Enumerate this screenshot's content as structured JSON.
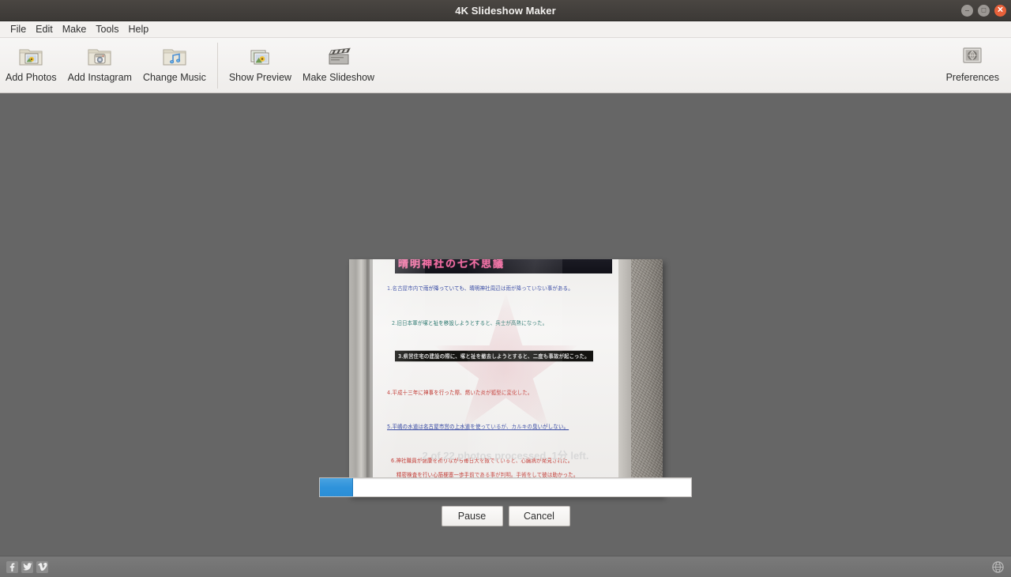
{
  "window": {
    "title": "4K Slideshow Maker",
    "controls": [
      {
        "name": "minimize",
        "glyph": "–"
      },
      {
        "name": "maximize",
        "glyph": "□"
      },
      {
        "name": "close",
        "glyph": "✕"
      }
    ]
  },
  "menubar": {
    "items": [
      {
        "label": "File"
      },
      {
        "label": "Edit"
      },
      {
        "label": "Make"
      },
      {
        "label": "Tools"
      },
      {
        "label": "Help"
      }
    ]
  },
  "toolbar": {
    "left_items": [
      {
        "label": "Add Photos",
        "icon": "folder-photo-icon"
      },
      {
        "label": "Add Instagram",
        "icon": "folder-instagram-icon"
      },
      {
        "label": "Change Music",
        "icon": "folder-music-icon"
      }
    ],
    "right_group_items": [
      {
        "label": "Show Preview",
        "icon": "photo-stack-icon"
      },
      {
        "label": "Make Slideshow",
        "icon": "clapperboard-icon"
      }
    ],
    "preferences": {
      "label": "Preferences",
      "icon": "preferences-globe-icon"
    }
  },
  "preview": {
    "alt": "photo of a Japanese notice board poster behind glass",
    "poster": {
      "header": "晴明神社の七不思議",
      "lines": [
        "1.名古屋市内で雨が降っていても、晴明神社周辺は雨が降っていない事がある。",
        "2.旧日本軍が塚と祉を移設しようとすると、兵士が高熱になった。",
        "3.県営住宅の建設の際に、塚と祉を撤去しようとすると、二度も事故が起こった。",
        "4.平成十三年に神事を行った際、燃いた炎が狐型に変化した。",
        "5.平嶋の水道は名古屋市営の上水道を使っているが、カルキの臭いがしない。",
        "6.神社職員が健康を祈りながら毎日犬を撒でていると、心臓病が発見された。",
        "精密検査を行い心筋梗塞一歩手前である事が判明。手術をして彼は助かった。"
      ]
    }
  },
  "progress": {
    "status_text": "2 of 22 photos processed, 1分 left.",
    "processed": 2,
    "total": 22,
    "time_left": "1分",
    "percent": 9,
    "fill_color": "#2f93db",
    "pause_label": "Pause",
    "cancel_label": "Cancel"
  },
  "statusbar": {
    "social": [
      {
        "name": "facebook",
        "glyph": "f"
      },
      {
        "name": "twitter",
        "glyph": "🐦"
      },
      {
        "name": "vimeo",
        "glyph": "v"
      }
    ],
    "language_icon": "globe-icon"
  },
  "colors": {
    "titlebar": "#403d39",
    "toolbar": "#f3f1ef",
    "canvas_bg": "#666666",
    "statusbar": "#747474",
    "accent_blue": "#2f93db",
    "close_red": "#e8613a"
  }
}
